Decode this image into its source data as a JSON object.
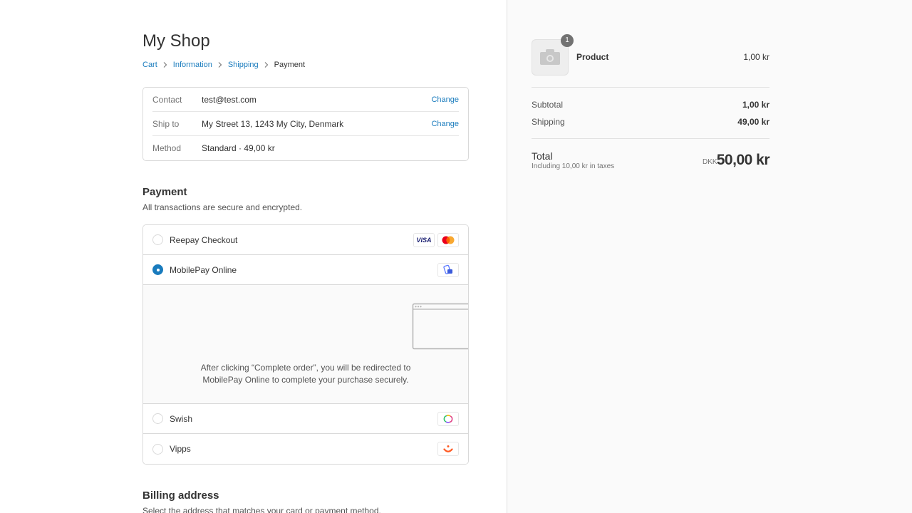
{
  "shop": {
    "title": "My Shop"
  },
  "breadcrumb": [
    {
      "label": "Cart"
    },
    {
      "label": "Information"
    },
    {
      "label": "Shipping"
    },
    {
      "label": "Payment"
    }
  ],
  "review": {
    "rows": [
      {
        "label": "Contact",
        "value": "test@test.com",
        "action": "Change"
      },
      {
        "label": "Ship to",
        "value": "My Street 13, 1243 My City, Denmark",
        "action": "Change"
      },
      {
        "label": "Method",
        "value": "Standard · 49,00 kr"
      }
    ]
  },
  "payment": {
    "title": "Payment",
    "subtitle": "All transactions are secure and encrypted.",
    "methods": [
      {
        "label": "Reepay Checkout",
        "selected": false,
        "icons": [
          "visa-icon",
          "mastercard-icon"
        ]
      },
      {
        "label": "MobilePay Online",
        "selected": true,
        "icons": [
          "mobilepay-icon"
        ]
      },
      {
        "label": "Swish",
        "selected": false,
        "icons": [
          "swish-icon"
        ]
      },
      {
        "label": "Vipps",
        "selected": false,
        "icons": [
          "vipps-icon"
        ]
      }
    ],
    "visa_text": "VISA",
    "redirect_line1": "After clicking “Complete order”, you will be redirected to",
    "redirect_line2": "MobilePay Online to complete your purchase securely."
  },
  "billing": {
    "title": "Billing address",
    "subtitle": "Select the address that matches your card or payment method."
  },
  "summary": {
    "product": {
      "name": "Product",
      "price": "1,00 kr",
      "quantity": "1"
    },
    "subtotal_label": "Subtotal",
    "subtotal_value": "1,00 kr",
    "shipping_label": "Shipping",
    "shipping_value": "49,00 kr",
    "total_label": "Total",
    "tax_note": "Including 10,00 kr in taxes",
    "currency": "DKK",
    "total_value": "50,00 kr"
  },
  "colors": {
    "accent": "#197bbd",
    "sidebar_bg": "#fafafa"
  }
}
